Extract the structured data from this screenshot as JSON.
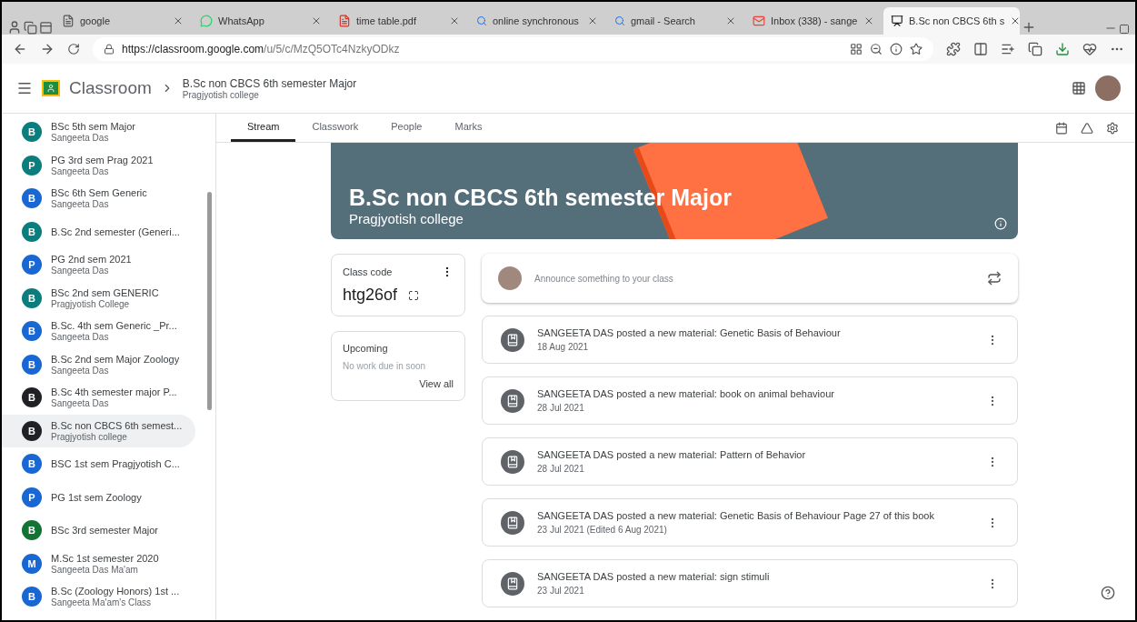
{
  "browser": {
    "tabs": [
      {
        "title": "google",
        "kind": "doc",
        "selected": false
      },
      {
        "title": "WhatsApp",
        "kind": "chat",
        "selected": false
      },
      {
        "title": "time table.pdf",
        "kind": "pdf",
        "selected": false
      },
      {
        "title": "online synchronous",
        "kind": "search",
        "selected": false
      },
      {
        "title": "gmail - Search",
        "kind": "search",
        "selected": false
      },
      {
        "title": "Inbox (338) - sange",
        "kind": "mail",
        "selected": false
      },
      {
        "title": "B.Sc non CBCS 6th s",
        "kind": "classroom",
        "selected": true
      }
    ],
    "url": {
      "host": "https://classroom.google.com",
      "path": "/u/5/c/MzQ5OTc4NzkyODkz"
    }
  },
  "header": {
    "app": "Classroom",
    "class_name": "B.Sc non CBCS 6th semester Major",
    "section": "Pragjyotish college"
  },
  "sidebar": {
    "items": [
      {
        "letter": "B",
        "name": "BSc 5th sem Major",
        "owner": "Sangeeta Das",
        "color": "#0b7d7d",
        "selected": false
      },
      {
        "letter": "P",
        "name": "PG 3rd sem Prag 2021",
        "owner": "Sangeeta Das",
        "color": "#0b7d7d",
        "selected": false
      },
      {
        "letter": "B",
        "name": "BSc 6th Sem Generic",
        "owner": "Sangeeta Das",
        "color": "#1967d2",
        "selected": false
      },
      {
        "letter": "B",
        "name": "B.Sc 2nd semester (Generi...",
        "color": "#0b7d7d",
        "selected": false
      },
      {
        "letter": "P",
        "name": "PG 2nd sem 2021",
        "owner": "Sangeeta Das",
        "color": "#1967d2",
        "selected": false
      },
      {
        "letter": "B",
        "name": "BSc 2nd sem GENERIC",
        "owner": "Pragjyotish College",
        "color": "#0b7d7d",
        "selected": false
      },
      {
        "letter": "B",
        "name": "B.Sc. 4th sem Generic _Pr...",
        "owner": "Sangeeta Das",
        "color": "#1967d2",
        "selected": false
      },
      {
        "letter": "B",
        "name": "B.Sc 2nd sem Major Zoology",
        "owner": "Sangeeta Das",
        "color": "#1967d2",
        "selected": false
      },
      {
        "letter": "B",
        "name": "B.Sc 4th semester major P...",
        "owner": "Sangeeta Das",
        "color": "#202124",
        "selected": false
      },
      {
        "letter": "B",
        "name": "B.Sc non CBCS 6th semest...",
        "owner": "Pragjyotish college",
        "color": "#202124",
        "selected": true
      },
      {
        "letter": "B",
        "name": "BSC 1st sem Pragjyotish C...",
        "color": "#1967d2",
        "selected": false
      },
      {
        "letter": "P",
        "name": "PG 1st sem Zoology",
        "color": "#1967d2",
        "selected": false
      },
      {
        "letter": "B",
        "name": "BSc 3rd semester Major",
        "color": "#137333",
        "selected": false
      },
      {
        "letter": "M",
        "name": "M.Sc 1st semester 2020",
        "owner": "Sangeeta Das Ma'am",
        "color": "#1967d2",
        "selected": false
      },
      {
        "letter": "B",
        "name": "B.Sc (Zoology Honors) 1st ...",
        "owner": "Sangeeta Ma'am's Class",
        "color": "#1967d2",
        "selected": false
      }
    ]
  },
  "tabs": [
    {
      "label": "Stream",
      "selected": true
    },
    {
      "label": "Classwork",
      "selected": false
    },
    {
      "label": "People",
      "selected": false
    },
    {
      "label": "Marks",
      "selected": false
    }
  ],
  "banner": {
    "title": "B.Sc non CBCS 6th semester Major",
    "subtitle": "Pragjyotish college"
  },
  "class_code": {
    "label": "Class code",
    "code": "htg26of"
  },
  "upcoming": {
    "title": "Upcoming",
    "message": "No work due in soon",
    "link": "View all"
  },
  "announce": {
    "placeholder": "Announce something to your class"
  },
  "posts": [
    {
      "text": "SANGEETA DAS posted a new material: Genetic Basis of Behaviour",
      "date": "18 Aug 2021"
    },
    {
      "text": "SANGEETA DAS posted a new material: book on animal behaviour",
      "date": "28 Jul 2021"
    },
    {
      "text": "SANGEETA DAS posted a new material: Pattern of Behavior",
      "date": "28 Jul 2021"
    },
    {
      "text": "SANGEETA DAS posted a new material: Genetic Basis of Behaviour Page 27 of this book",
      "date": "23 Jul 2021 (Edited 6 Aug 2021)"
    },
    {
      "text": "SANGEETA DAS posted a new material: sign stimuli",
      "date": "23 Jul 2021"
    }
  ]
}
